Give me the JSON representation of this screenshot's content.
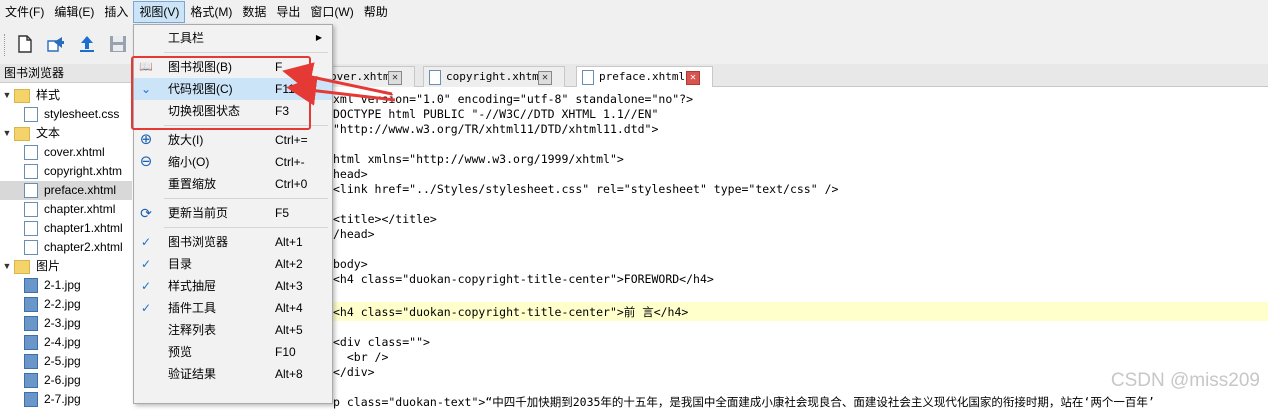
{
  "menubar": [
    "文件(F)",
    "编辑(E)",
    "插入",
    "视图(V)",
    "格式(M)",
    "数据",
    "导出",
    "窗口(W)",
    "帮助"
  ],
  "sidebar": {
    "title": "图书浏览器",
    "nodes": [
      {
        "label": "样式",
        "type": "folder"
      },
      {
        "label": "stylesheet.css",
        "type": "file"
      },
      {
        "label": "文本",
        "type": "folder"
      },
      {
        "label": "cover.xhtml",
        "type": "file"
      },
      {
        "label": "copyright.xhtm",
        "type": "file"
      },
      {
        "label": "preface.xhtml",
        "type": "file"
      },
      {
        "label": "chapter.xhtml",
        "type": "file"
      },
      {
        "label": "chapter1.xhtml",
        "type": "file"
      },
      {
        "label": "chapter2.xhtml",
        "type": "file"
      },
      {
        "label": "图片",
        "type": "folder"
      },
      {
        "label": "2-1.jpg",
        "type": "image"
      },
      {
        "label": "2-2.jpg",
        "type": "image"
      },
      {
        "label": "2-3.jpg",
        "type": "image"
      },
      {
        "label": "2-4.jpg",
        "type": "image"
      },
      {
        "label": "2-5.jpg",
        "type": "image"
      },
      {
        "label": "2-6.jpg",
        "type": "image"
      },
      {
        "label": "2-7.jpg",
        "type": "image"
      }
    ]
  },
  "tabs": [
    {
      "label": "over.xhtml"
    },
    {
      "label": "copyright.xhtml"
    },
    {
      "label": "preface.xhtml"
    }
  ],
  "code_lines": [
    "xml version=\"1.0\" encoding=\"utf-8\" standalone=\"no\"?>",
    "DOCTYPE html PUBLIC \"-//W3C//DTD XHTML 1.1//EN\"",
    "\"http://www.w3.org/TR/xhtml11/DTD/xhtml11.dtd\">",
    "",
    "html xmlns=\"http://www.w3.org/1999/xhtml\">",
    "head>",
    "<link href=\"../Styles/stylesheet.css\" rel=\"stylesheet\" type=\"text/css\" />",
    "",
    "<title></title>",
    "/head>",
    "",
    "body>",
    "<h4 class=\"duokan-copyright-title-center\">FOREWORD</h4>",
    "",
    "<h4 class=\"duokan-copyright-title-center\">前 言</h4>",
    "",
    "<div class=\"\">",
    "  <br />",
    "</div>",
    "",
    "p class=\"duokan-text\">“中四千加快期到2035年的十五年，是我国中全面建成小康社会现良合、面建设社会主义现代化国家的衔接时期，站在‘两个一百年’"
  ],
  "view_menu": [
    {
      "label": "工具栏",
      "key": "",
      "icon": "",
      "submenu": true
    },
    {
      "sep": true
    },
    {
      "label": "图书视图(B)",
      "key": "F",
      "icon": "book-icon"
    },
    {
      "label": "代码视图(C)",
      "key": "F11",
      "icon": "code-icon",
      "hover": true
    },
    {
      "label": "切换视图状态",
      "key": "F3",
      "icon": ""
    },
    {
      "sep": true
    },
    {
      "label": "放大(I)",
      "key": "Ctrl+=",
      "icon": "zoom-in-icon"
    },
    {
      "label": "缩小(O)",
      "key": "Ctrl+-",
      "icon": "zoom-out-icon"
    },
    {
      "label": "重置缩放",
      "key": "Ctrl+0",
      "icon": ""
    },
    {
      "sep": true
    },
    {
      "label": "更新当前页",
      "key": "F5",
      "icon": "refresh-icon"
    },
    {
      "sep": true
    },
    {
      "label": "图书浏览器",
      "key": "Alt+1",
      "icon": "check",
      "checked": true
    },
    {
      "label": "目录",
      "key": "Alt+2",
      "icon": "check",
      "checked": true
    },
    {
      "label": "样式抽屉",
      "key": "Alt+3",
      "icon": "check",
      "checked": true
    },
    {
      "label": "插件工具",
      "key": "Alt+4",
      "icon": "check",
      "checked": true
    },
    {
      "label": "注释列表",
      "key": "Alt+5",
      "icon": ""
    },
    {
      "label": "预览",
      "key": "F10",
      "icon": ""
    },
    {
      "label": "验证结果",
      "key": "Alt+8",
      "icon": ""
    }
  ],
  "watermark": "CSDN @miss209",
  "colors": {
    "accent": "#cce4f7",
    "annotation": "#e53935",
    "highlight_line": "#ffffcc"
  }
}
